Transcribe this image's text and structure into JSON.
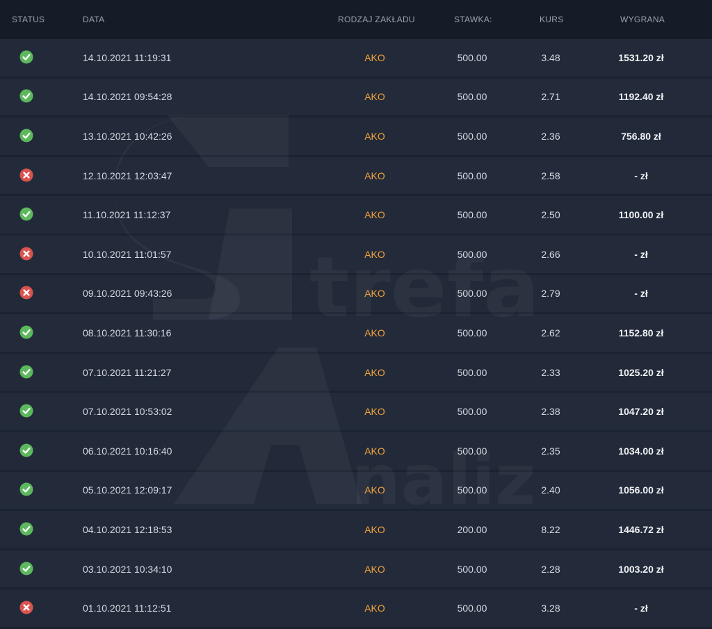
{
  "header": {
    "status": "STATUS",
    "date": "DATA",
    "bet_type": "RODZAJ ZAKŁADU",
    "stake": "STAWKA:",
    "odds": "KURS",
    "win": "WYGRANA"
  },
  "watermark": {
    "text": "StrefaAnaliz"
  },
  "colors": {
    "won": "#5cb85c",
    "lost": "#d9534f",
    "bet_type": "#f2a23a",
    "background": "#161c27",
    "row": "#222a39"
  },
  "rows": [
    {
      "status": "won",
      "icon": "check-circle-icon",
      "date": "14.10.2021 11:19:31",
      "type": "AKO",
      "stake": "500.00",
      "odds": "3.48",
      "win": "1531.20 zł"
    },
    {
      "status": "won",
      "icon": "check-circle-icon",
      "date": "14.10.2021 09:54:28",
      "type": "AKO",
      "stake": "500.00",
      "odds": "2.71",
      "win": "1192.40 zł"
    },
    {
      "status": "won",
      "icon": "check-circle-icon",
      "date": "13.10.2021 10:42:26",
      "type": "AKO",
      "stake": "500.00",
      "odds": "2.36",
      "win": "756.80 zł"
    },
    {
      "status": "lost",
      "icon": "x-circle-icon",
      "date": "12.10.2021 12:03:47",
      "type": "AKO",
      "stake": "500.00",
      "odds": "2.58",
      "win": "- zł"
    },
    {
      "status": "won",
      "icon": "check-circle-icon",
      "date": "11.10.2021 11:12:37",
      "type": "AKO",
      "stake": "500.00",
      "odds": "2.50",
      "win": "1100.00 zł"
    },
    {
      "status": "lost",
      "icon": "x-circle-icon",
      "date": "10.10.2021 11:01:57",
      "type": "AKO",
      "stake": "500.00",
      "odds": "2.66",
      "win": "- zł"
    },
    {
      "status": "lost",
      "icon": "x-circle-icon",
      "date": "09.10.2021 09:43:26",
      "type": "AKO",
      "stake": "500.00",
      "odds": "2.79",
      "win": "- zł"
    },
    {
      "status": "won",
      "icon": "check-circle-icon",
      "date": "08.10.2021 11:30:16",
      "type": "AKO",
      "stake": "500.00",
      "odds": "2.62",
      "win": "1152.80 zł"
    },
    {
      "status": "won",
      "icon": "check-circle-icon",
      "date": "07.10.2021 11:21:27",
      "type": "AKO",
      "stake": "500.00",
      "odds": "2.33",
      "win": "1025.20 zł"
    },
    {
      "status": "won",
      "icon": "check-circle-icon",
      "date": "07.10.2021 10:53:02",
      "type": "AKO",
      "stake": "500.00",
      "odds": "2.38",
      "win": "1047.20 zł"
    },
    {
      "status": "won",
      "icon": "check-circle-icon",
      "date": "06.10.2021 10:16:40",
      "type": "AKO",
      "stake": "500.00",
      "odds": "2.35",
      "win": "1034.00 zł"
    },
    {
      "status": "won",
      "icon": "check-circle-icon",
      "date": "05.10.2021 12:09:17",
      "type": "AKO",
      "stake": "500.00",
      "odds": "2.40",
      "win": "1056.00 zł"
    },
    {
      "status": "won",
      "icon": "check-circle-icon",
      "date": "04.10.2021 12:18:53",
      "type": "AKO",
      "stake": "200.00",
      "odds": "8.22",
      "win": "1446.72 zł"
    },
    {
      "status": "won",
      "icon": "check-circle-icon",
      "date": "03.10.2021 10:34:10",
      "type": "AKO",
      "stake": "500.00",
      "odds": "2.28",
      "win": "1003.20 zł"
    },
    {
      "status": "lost",
      "icon": "x-circle-icon",
      "date": "01.10.2021 11:12:51",
      "type": "AKO",
      "stake": "500.00",
      "odds": "3.28",
      "win": "- zł"
    }
  ]
}
